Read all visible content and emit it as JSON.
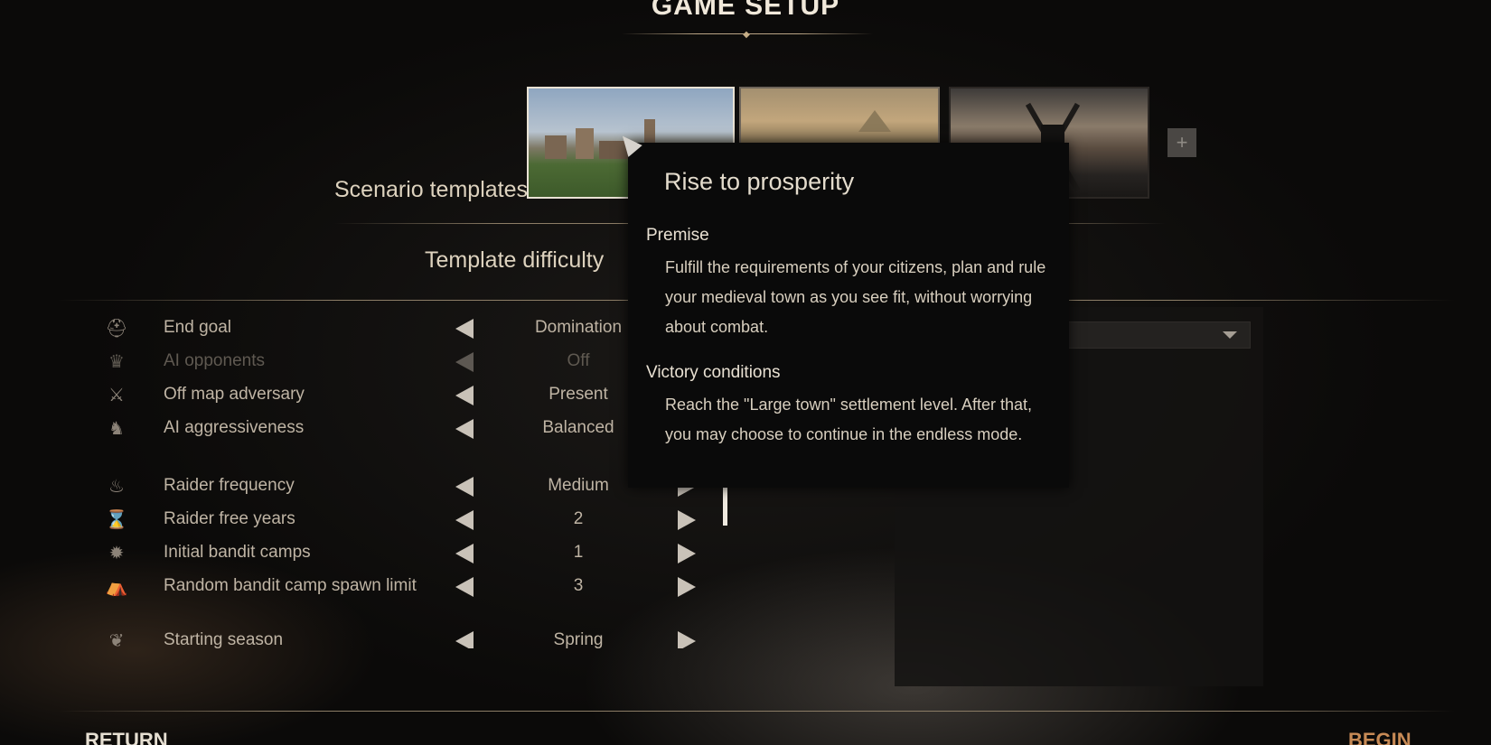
{
  "header": {
    "title": "GAME SETUP",
    "ornament_icon": "diamond-ornament"
  },
  "scenario": {
    "label": "Scenario templates",
    "thumbnails": [
      {
        "id": "rise-to-prosperity",
        "selected": true
      },
      {
        "id": "fields",
        "selected": false
      },
      {
        "id": "windmill",
        "selected": false
      }
    ],
    "add_label": "+"
  },
  "difficulty": {
    "label": "Template difficulty"
  },
  "settings": [
    {
      "icon": "helmet-icon",
      "label": "End goal",
      "value": "Domination",
      "enabled": true
    },
    {
      "icon": "crown-icon",
      "label": "AI opponents",
      "value": "Off",
      "enabled": false
    },
    {
      "icon": "crossed-swords-icon",
      "label": "Off map adversary",
      "value": "Present",
      "enabled": true
    },
    {
      "icon": "knight-icon",
      "label": "AI aggressiveness",
      "value": "Balanced",
      "enabled": true
    },
    {
      "icon": "flame-icon",
      "label": "Raider frequency",
      "value": "Medium",
      "enabled": true
    },
    {
      "icon": "hourglass-icon",
      "label": "Raider free years",
      "value": "2",
      "enabled": true
    },
    {
      "icon": "campfire-icon",
      "label": "Initial bandit camps",
      "value": "1",
      "enabled": true
    },
    {
      "icon": "tent-icon",
      "label": "Random bandit camp spawn limit",
      "value": "3",
      "enabled": true
    },
    {
      "icon": "season-icon",
      "label": "Starting season",
      "value": "Spring",
      "enabled": true
    }
  ],
  "tooltip": {
    "title": "Rise to prosperity",
    "premise_heading": "Premise",
    "premise_text": "Fulfill the requirements of your citizens, plan and rule your medieval town as you see fit, without worrying about combat.",
    "victory_heading": "Victory conditions",
    "victory_text": "Reach the \"Large town\" settlement level. After that, you may choose to continue in the endless mode."
  },
  "footer": {
    "return_label": "RETURN",
    "begin_label": "BEGIN"
  },
  "colors": {
    "accent": "#c78a55",
    "text": "#bfb4a4",
    "disabled": "#5f5951"
  }
}
